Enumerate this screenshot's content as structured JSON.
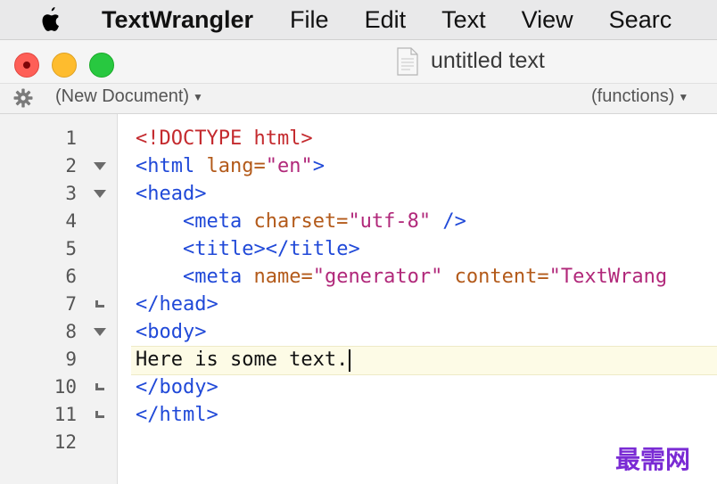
{
  "menubar": {
    "app_name": "TextWrangler",
    "items": [
      "File",
      "Edit",
      "Text",
      "View",
      "Searc"
    ]
  },
  "window": {
    "title": "untitled text",
    "nav": {
      "document_menu": "(New Document)",
      "functions_menu": "(functions)"
    }
  },
  "editor": {
    "current_line": 9,
    "lines": [
      {
        "num": "1",
        "fold": "none",
        "text": "<!DOCTYPE html>"
      },
      {
        "num": "2",
        "fold": "open",
        "text": "<html lang=\"en\">"
      },
      {
        "num": "3",
        "fold": "open",
        "text": "<head>"
      },
      {
        "num": "4",
        "fold": "none",
        "text": "    <meta charset=\"utf-8\" />"
      },
      {
        "num": "5",
        "fold": "none",
        "text": "    <title></title>"
      },
      {
        "num": "6",
        "fold": "none",
        "text": "    <meta name=\"generator\" content=\"TextWrang"
      },
      {
        "num": "7",
        "fold": "end",
        "text": "</head>"
      },
      {
        "num": "8",
        "fold": "open",
        "text": "<body>"
      },
      {
        "num": "9",
        "fold": "none",
        "text": "Here is some text."
      },
      {
        "num": "10",
        "fold": "end",
        "text": "</body>"
      },
      {
        "num": "11",
        "fold": "end",
        "text": "</html>"
      },
      {
        "num": "12",
        "fold": "none",
        "text": ""
      }
    ]
  },
  "watermark": "最需网",
  "colors": {
    "doctype": "#c42a2e",
    "tag": "#2049d8",
    "attribute": "#b35a1a",
    "value": "#b1287a",
    "highlight_line": "#fdfbe6"
  }
}
